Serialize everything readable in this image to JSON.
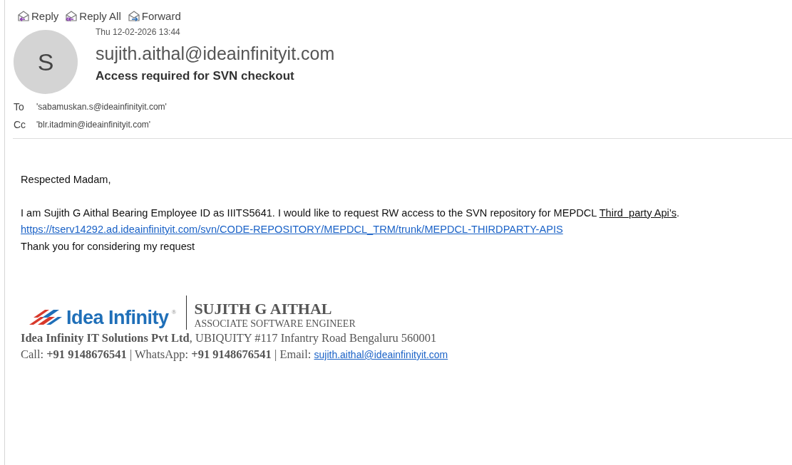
{
  "toolbar": [
    {
      "kind": "reply",
      "label": "Reply"
    },
    {
      "kind": "reply_all",
      "label": "Reply All"
    },
    {
      "kind": "forward",
      "label": "Forward"
    }
  ],
  "message": {
    "avatar_initial": "S",
    "date": "Thu 12-02-2026 13:44",
    "sender": "sujith.aithal@ideainfinityit.com",
    "subject": "Access required for SVN checkout",
    "recipients": [
      {
        "label": "To",
        "address": "'sabamuskan.s@ideainfinityit.com'"
      },
      {
        "label": "Cc",
        "address": "'blr.itadmin@ideainfinityit.com'"
      }
    ]
  },
  "body": {
    "greeting": "Respected Madam,",
    "paragraph_before": "I am Sujith G Aithal Bearing Employee ID as IIITS5641. I would like to request RW access to the SVN repository for MEPDCL ",
    "paragraph_link": "Third  party Api’s",
    "paragraph_after": ".",
    "url": "https://tserv14292.ad.ideainfinityit.com/svn/CODE-REPOSITORY/MEPDCL_TRM/trunk/MEPDCL-THIRDPARTY-APIS",
    "closing": "Thank you for considering my request"
  },
  "signature": {
    "logo_text": "Idea Infinity",
    "logo_mark": "®",
    "name": "SUJITH G AITHAL",
    "title": "ASSOCIATE SOFTWARE ENGINEER",
    "company": "Idea Infinity IT Solutions Pvt Ltd",
    "address": ", UBIQUITY #117 Infantry Road Bengaluru 560001",
    "contact_line": "Call: **+91 9148676541** | WhatsApp: **+91 9148676541** | Email: ",
    "email": "sujith.aithal@ideainfinityit.com"
  }
}
